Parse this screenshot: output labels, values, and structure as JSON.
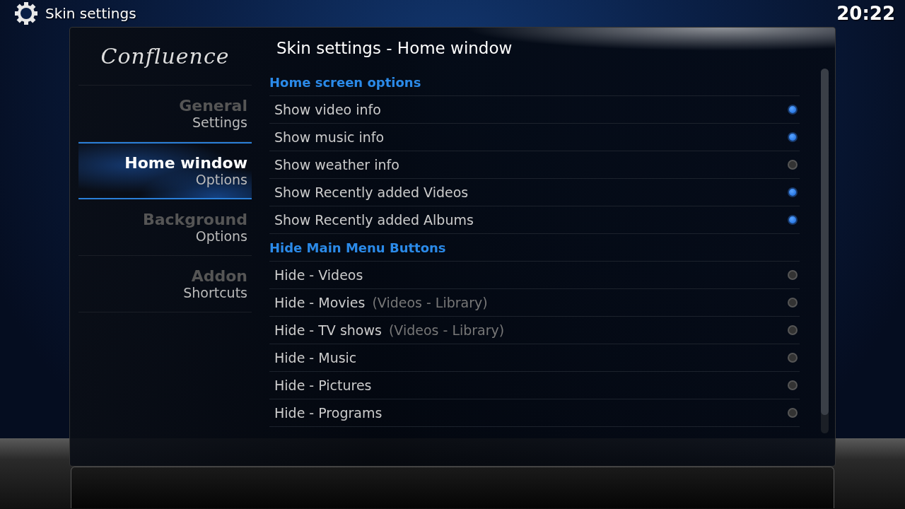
{
  "header": {
    "title": "Skin settings",
    "clock": "20:22"
  },
  "logo": "Confluence",
  "menu": [
    {
      "title": "General",
      "subtitle": "Settings",
      "selected": false
    },
    {
      "title": "Home window",
      "subtitle": "Options",
      "selected": true
    },
    {
      "title": "Background",
      "subtitle": "Options",
      "selected": false
    },
    {
      "title": "Addon",
      "subtitle": "Shortcuts",
      "selected": false
    }
  ],
  "content": {
    "title": "Skin settings - Home window",
    "sections": [
      {
        "heading": "Home screen options",
        "options": [
          {
            "label": "Show video info",
            "on": true
          },
          {
            "label": "Show music info",
            "on": true
          },
          {
            "label": "Show weather info",
            "on": false
          },
          {
            "label": "Show Recently added Videos",
            "on": true
          },
          {
            "label": "Show Recently added Albums",
            "on": true
          }
        ]
      },
      {
        "heading": "Hide Main Menu Buttons",
        "options": [
          {
            "label": "Hide - Videos",
            "on": false
          },
          {
            "label": "Hide - Movies",
            "note": "(Videos - Library)",
            "on": false
          },
          {
            "label": "Hide - TV shows",
            "note": "(Videos - Library)",
            "on": false
          },
          {
            "label": "Hide - Music",
            "on": false
          },
          {
            "label": "Hide - Pictures",
            "on": false
          },
          {
            "label": "Hide - Programs",
            "on": false
          }
        ]
      }
    ]
  }
}
